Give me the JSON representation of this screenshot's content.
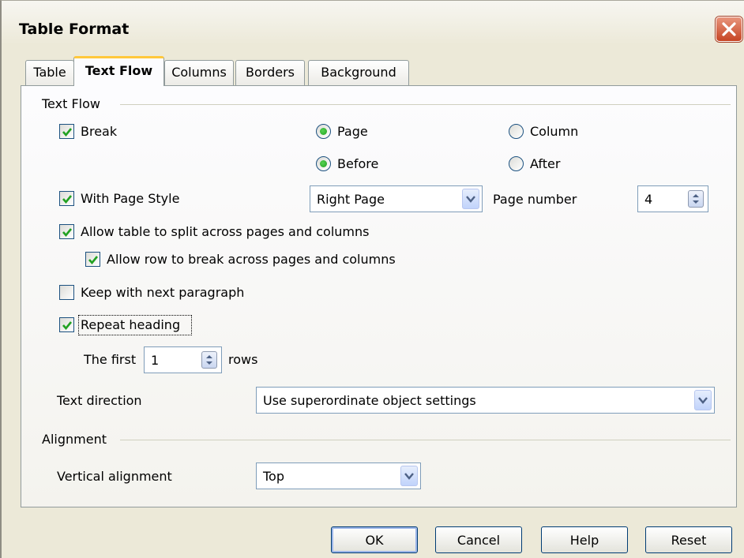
{
  "window": {
    "title": "Table Format"
  },
  "tabs": [
    {
      "label": "Table",
      "active": false
    },
    {
      "label": "Text Flow",
      "active": true
    },
    {
      "label": "Columns",
      "active": false
    },
    {
      "label": "Borders",
      "active": false
    },
    {
      "label": "Background",
      "active": false
    }
  ],
  "text_flow": {
    "group_label": "Text Flow",
    "break": {
      "label": "Break",
      "checked": true
    },
    "page_radio": {
      "label": "Page",
      "selected": true
    },
    "column_radio": {
      "label": "Column",
      "selected": false
    },
    "before_radio": {
      "label": "Before",
      "selected": true
    },
    "after_radio": {
      "label": "After",
      "selected": false
    },
    "with_page_style": {
      "label": "With Page Style",
      "checked": true
    },
    "page_style_value": "Right Page",
    "page_number_label": "Page number",
    "page_number_value": "4",
    "allow_split": {
      "label": "Allow table to split across pages and columns",
      "checked": true
    },
    "allow_row_break": {
      "label": "Allow row to break across pages and columns",
      "checked": true
    },
    "keep_with_next": {
      "label": "Keep with next paragraph",
      "checked": false
    },
    "repeat_heading": {
      "label": "Repeat heading",
      "checked": true
    },
    "first_label": "The first",
    "first_value": "1",
    "rows_label": "rows",
    "text_direction_label": "Text direction",
    "text_direction_value": "Use superordinate object settings"
  },
  "alignment": {
    "group_label": "Alignment",
    "vertical_label": "Vertical alignment",
    "vertical_value": "Top"
  },
  "buttons": {
    "ok": "OK",
    "cancel": "Cancel",
    "help": "Help",
    "reset": "Reset"
  },
  "colors": {
    "accent_tab": "#ffc83c",
    "check": "#21a121",
    "close": "#c64524"
  }
}
